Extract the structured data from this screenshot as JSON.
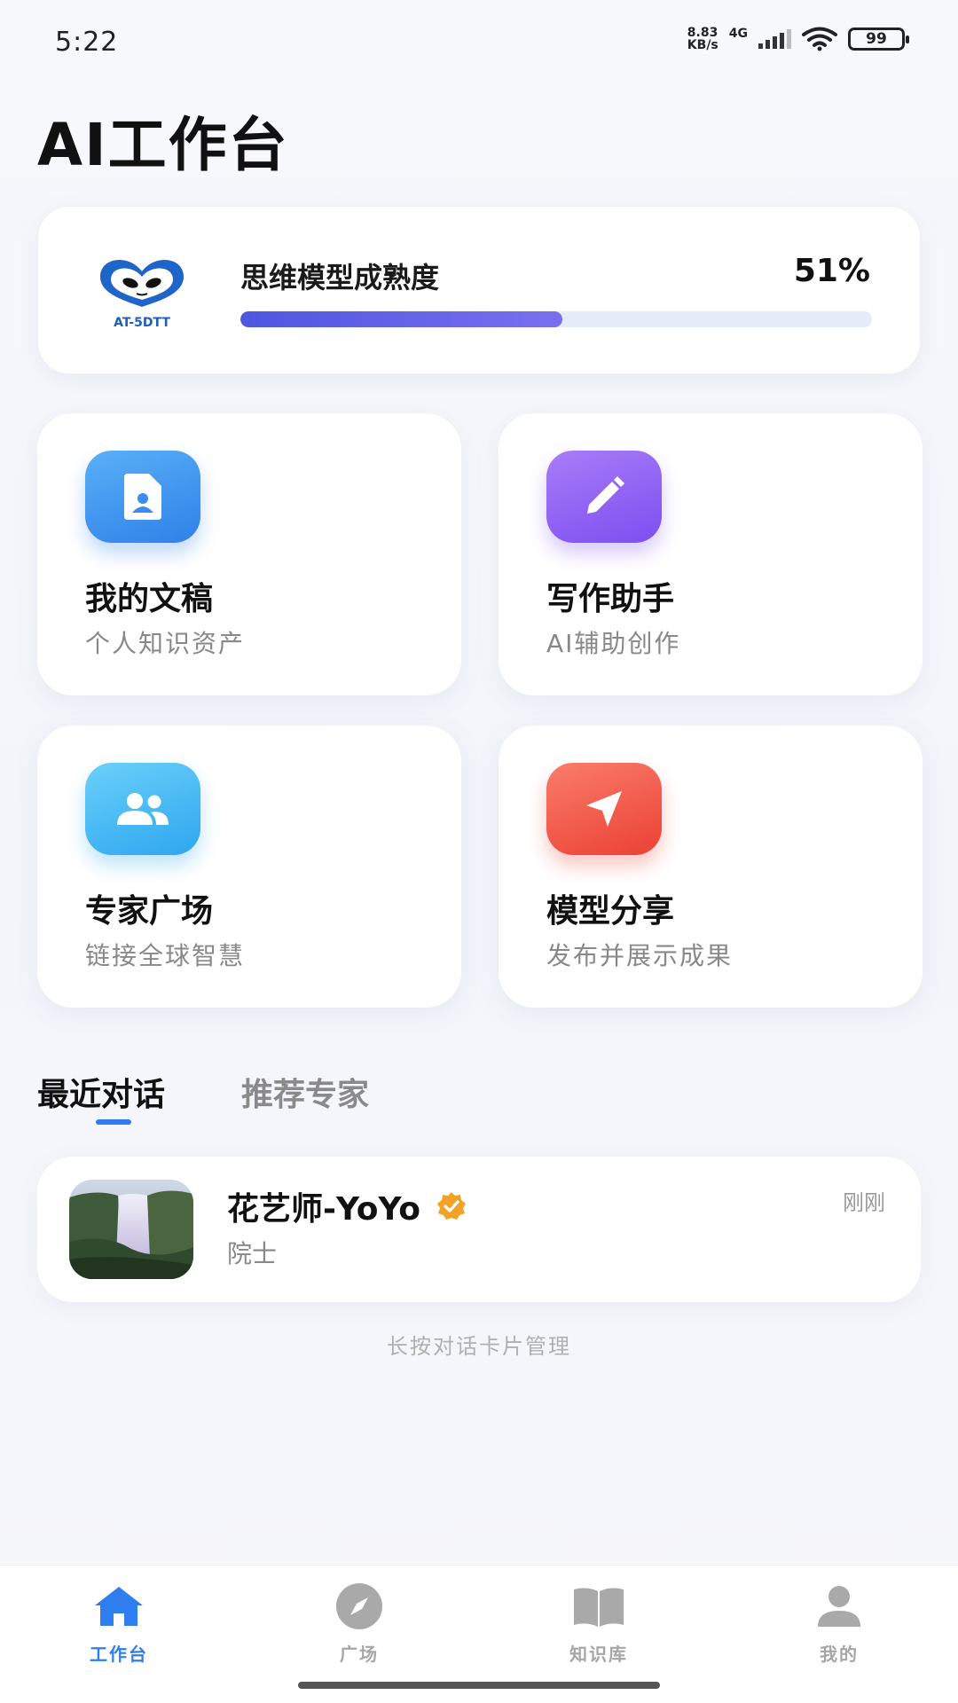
{
  "status_bar": {
    "time": "5:22",
    "net_speed_value": "8.83",
    "net_speed_unit": "KB/s",
    "network": "4G",
    "battery": "99"
  },
  "page": {
    "title": "AI工作台"
  },
  "maturity": {
    "logo_text": "AT-5DTT",
    "label": "思维模型成熟度",
    "value_text": "51%",
    "value_fraction": 0.51
  },
  "features": [
    {
      "title": "我的文稿",
      "subtitle": "个人知识资产",
      "icon": "document-person-icon",
      "color": "#2f80e8"
    },
    {
      "title": "写作助手",
      "subtitle": "AI辅助创作",
      "icon": "pencil-icon",
      "color": "#7c4ff0"
    },
    {
      "title": "专家广场",
      "subtitle": "链接全球智慧",
      "icon": "group-icon",
      "color": "#2ea6ef"
    },
    {
      "title": "模型分享",
      "subtitle": "发布并展示成果",
      "icon": "send-icon",
      "color": "#ea4134"
    }
  ],
  "tabs": [
    {
      "label": "最近对话",
      "active": true
    },
    {
      "label": "推荐专家",
      "active": false
    }
  ],
  "conversations": [
    {
      "name": "花艺师-YoYo",
      "role": "院士",
      "time": "刚刚",
      "verified": true
    }
  ],
  "hint": "长按对话卡片管理",
  "nav": [
    {
      "label": "工作台",
      "icon": "home-icon",
      "active": true
    },
    {
      "label": "广场",
      "icon": "compass-icon",
      "active": false
    },
    {
      "label": "知识库",
      "icon": "book-icon",
      "active": false
    },
    {
      "label": "我的",
      "icon": "user-icon",
      "active": false
    }
  ],
  "colors": {
    "accent": "#2f7ef0",
    "progress": "#5a5ee6"
  }
}
